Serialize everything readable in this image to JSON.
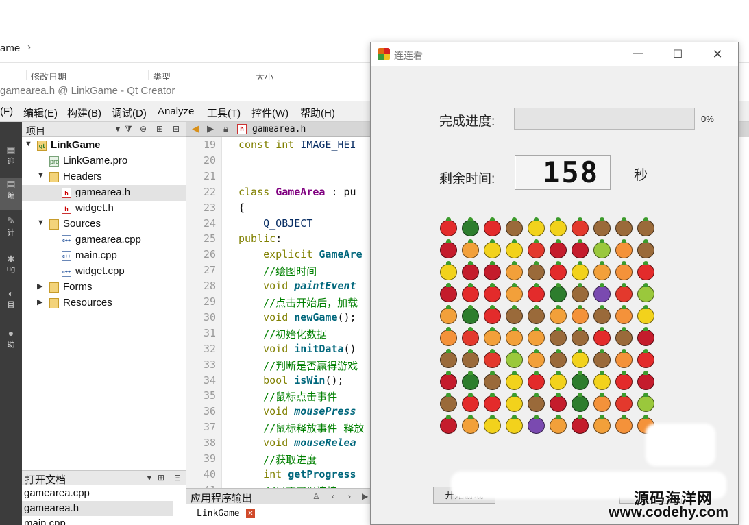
{
  "explorer": {
    "breadcrumb": "ame",
    "chevron": "›",
    "columns": [
      "修改日期",
      "类型",
      "大小"
    ]
  },
  "qt": {
    "window_title": "gamearea.h @ LinkGame - Qt Creator",
    "menu": [
      "(F)",
      "编辑(E)",
      "构建(B)",
      "调试(D)",
      "Analyze",
      "工具(T)",
      "控件(W)",
      "帮助(H)"
    ],
    "modes": [
      "迎",
      "编",
      "计",
      "ug",
      "目",
      "助"
    ],
    "project_panel": {
      "title": "项目",
      "tree": [
        {
          "label": "LinkGame",
          "type": "project",
          "icon": "project-folder-icon",
          "arrow": "▼"
        },
        {
          "label": "LinkGame.pro",
          "type": "pro",
          "icon": "pro-file-icon",
          "badge": "pro"
        },
        {
          "label": "Headers",
          "type": "folder",
          "icon": "folder-icon",
          "arrow": "▼"
        },
        {
          "label": "gamearea.h",
          "type": "header",
          "icon": "header-file-icon",
          "badge": "h",
          "selected": true
        },
        {
          "label": "widget.h",
          "type": "header",
          "icon": "header-file-icon",
          "badge": "h"
        },
        {
          "label": "Sources",
          "type": "folder",
          "icon": "folder-icon",
          "arrow": "▼"
        },
        {
          "label": "gamearea.cpp",
          "type": "source",
          "icon": "cpp-file-icon",
          "badge": "c++"
        },
        {
          "label": "main.cpp",
          "type": "source",
          "icon": "cpp-file-icon",
          "badge": "c++"
        },
        {
          "label": "widget.cpp",
          "type": "source",
          "icon": "cpp-file-icon",
          "badge": "c++"
        },
        {
          "label": "Forms",
          "type": "folder",
          "icon": "folder-icon",
          "arrow": "▶"
        },
        {
          "label": "Resources",
          "type": "folder",
          "icon": "folder-icon",
          "arrow": "▶"
        }
      ]
    },
    "open_docs": {
      "title": "打开文档",
      "items": [
        "gamearea.cpp",
        "gamearea.h",
        "main.cpp"
      ]
    },
    "editor": {
      "tab_file": "gamearea.h",
      "lines": [
        {
          "n": "19",
          "text": "const int IMAGE_HEI"
        },
        {
          "n": "20",
          "text": ""
        },
        {
          "n": "21",
          "text": ""
        },
        {
          "n": "22",
          "text": "class GameArea : pu"
        },
        {
          "n": "23",
          "text": "{"
        },
        {
          "n": "24",
          "text": "    Q_OBJECT"
        },
        {
          "n": "25",
          "text": "public:"
        },
        {
          "n": "26",
          "text": "    explicit GameAre"
        },
        {
          "n": "27",
          "text": "    //绘图时间"
        },
        {
          "n": "28",
          "text": "    void paintEvent"
        },
        {
          "n": "29",
          "text": "    //点击开始后，加载"
        },
        {
          "n": "30",
          "text": "    void newGame();"
        },
        {
          "n": "31",
          "text": "    //初始化数据"
        },
        {
          "n": "32",
          "text": "    void initData()"
        },
        {
          "n": "33",
          "text": "    //判断是否赢得游戏"
        },
        {
          "n": "34",
          "text": "    bool isWin();"
        },
        {
          "n": "35",
          "text": "    //鼠标点击事件"
        },
        {
          "n": "36",
          "text": "    void mousePress"
        },
        {
          "n": "37",
          "text": "    //鼠标释放事件 释放"
        },
        {
          "n": "38",
          "text": "    void mouseRelea"
        },
        {
          "n": "39",
          "text": "    //获取进度"
        },
        {
          "n": "40",
          "text": "    int getProgress"
        },
        {
          "n": "41",
          "text": "    //是否可以连接"
        }
      ]
    },
    "output": {
      "title": "应用程序输出",
      "tab": "LinkGame"
    }
  },
  "game": {
    "title": "连连看",
    "progress_label": "完成进度:",
    "progress_value": 0,
    "progress_text": "0%",
    "time_label": "剩余时间:",
    "time_value": "158",
    "time_unit": "秒",
    "start_button": "开始游戏",
    "fruit_colors": {
      "S": "#e32b2b",
      "W": "#2d7d2d",
      "C": "#9a6a3a",
      "L": "#f2d21c",
      "A": "#e3392d",
      "R": "#c41c2c",
      "M": "#f2a03a",
      "P": "#9ac83c",
      "O": "#f4923a",
      "G": "#7a4ab0"
    },
    "board": [
      "SWSCLLACCC",
      "RMLLARRPOC",
      "LRRMCSLMOS",
      "RSSMSWCGAP",
      "MWSCCMOCOL",
      "OAMMMCCSCR",
      "CCAPMCLCOS",
      "RWCLSLWLSR",
      "CSSLCRWOAP",
      "RMLLGMRMOO"
    ]
  },
  "watermark": {
    "cn": "源码海洋网",
    "url": "www.codehy.com"
  }
}
